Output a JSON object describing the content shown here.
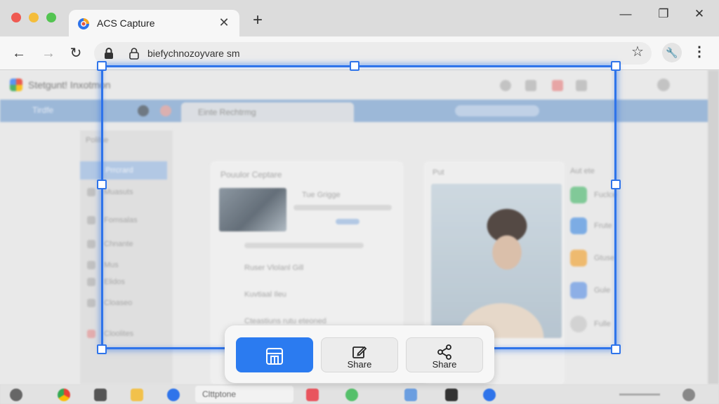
{
  "browser": {
    "tab_title": "ACS Capture",
    "tab_close": "✕",
    "new_tab": "+",
    "url": "biefychnozoyvare sm",
    "window_controls": {
      "minimize": "—",
      "maximize": "❐",
      "close": "✕"
    }
  },
  "background_page": {
    "title": "Stetgunt! Inxotmon",
    "toolbar_text": "Tirdfe",
    "inner_tab": "Einte Rechtrmg",
    "sidebar": {
      "heading": "Polilse",
      "selected": "Prrcrard",
      "items": [
        "Muasuts",
        "Fomsalas",
        "Chnante",
        "Mus",
        "Elidos",
        "Cloaseo",
        "Cloolites"
      ]
    },
    "card": {
      "title": "Pouulor Ceptare",
      "rows": [
        "Tue Grigge",
        "Ruser Vlolanl Gill",
        "Kuvtiaal Ileu",
        "Cteastiuns rutu eteoned"
      ]
    },
    "photo_panel_label": "Put",
    "apps_header": "Aut ete",
    "apps": [
      "Fuclce",
      "Frute",
      "Gtuse",
      "Gule",
      "Fulle"
    ]
  },
  "taskbar": {
    "label": "Clttptone"
  },
  "action_bar": {
    "primary_icon": "capture-frame-icon",
    "edit_label": "Share",
    "share_label": "Share"
  },
  "colors": {
    "accent": "#2f74ea",
    "primary_button": "#2b7bf0"
  }
}
